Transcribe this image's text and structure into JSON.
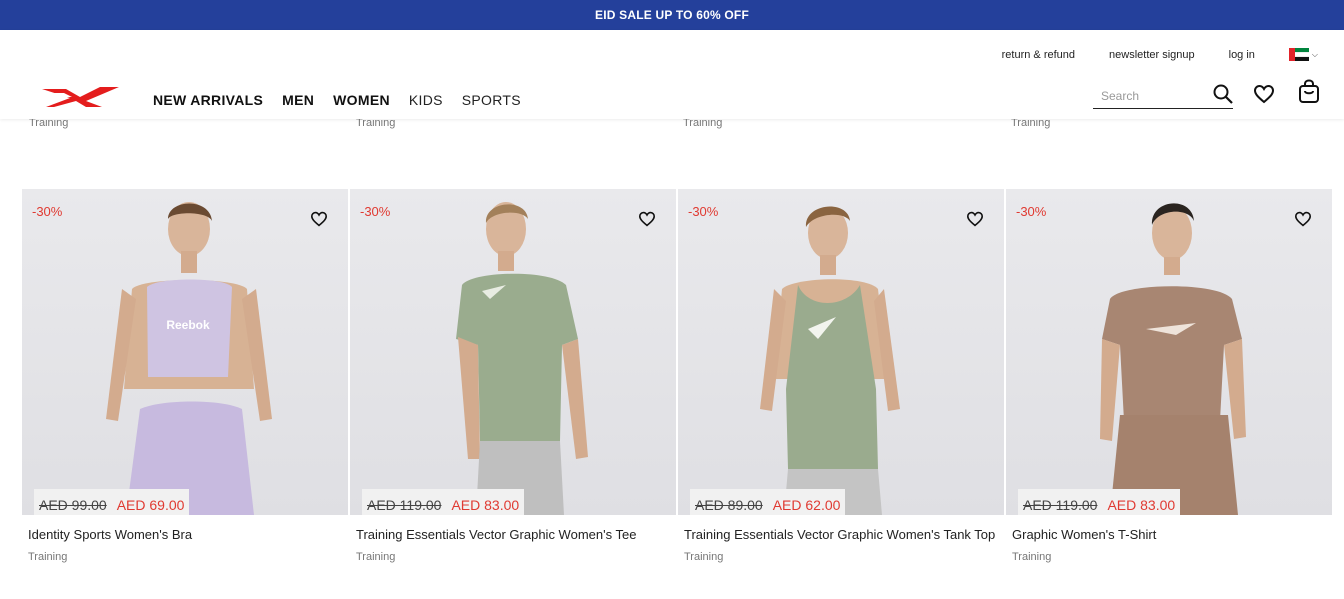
{
  "promo": {
    "text": "EID SALE UP TO 60% OFF"
  },
  "utility_links": {
    "return_refund": "return & refund",
    "newsletter": "newsletter signup",
    "login": "log in"
  },
  "nav": [
    "NEW ARRIVALS",
    "MEN",
    "WOMEN",
    "KIDS",
    "SPORTS"
  ],
  "search": {
    "placeholder": "Search"
  },
  "previous_row_categories": [
    "Training",
    "Training",
    "Training",
    "Training"
  ],
  "products": [
    {
      "discount": "-30%",
      "old_price": "AED 99.00",
      "new_price": "AED 69.00",
      "name": "Identity Sports Women's Bra",
      "category": "Training",
      "garment_color": "#cfc4e2",
      "bottom_color": "#c7badf",
      "garment_logo": "Reebok"
    },
    {
      "discount": "-30%",
      "old_price": "AED 119.00",
      "new_price": "AED 83.00",
      "name": "Training Essentials Vector Graphic Women's Tee",
      "category": "Training",
      "garment_color": "#9aac8e",
      "bottom_color": "#bfbfbf"
    },
    {
      "discount": "-30%",
      "old_price": "AED 89.00",
      "new_price": "AED 62.00",
      "name": "Training Essentials Vector Graphic Women's Tank Top",
      "category": "Training",
      "garment_color": "#9aab8e",
      "bottom_color": "#c4c4c4"
    },
    {
      "discount": "-30%",
      "old_price": "AED 119.00",
      "new_price": "AED 83.00",
      "name": "Graphic Women's T-Shirt",
      "category": "Training",
      "garment_color": "#a88672",
      "bottom_color": "#a5826d"
    }
  ],
  "colors": {
    "promo_bg": "#24409b",
    "logo_red": "#e41d1d",
    "discount_red": "#e03a32"
  }
}
